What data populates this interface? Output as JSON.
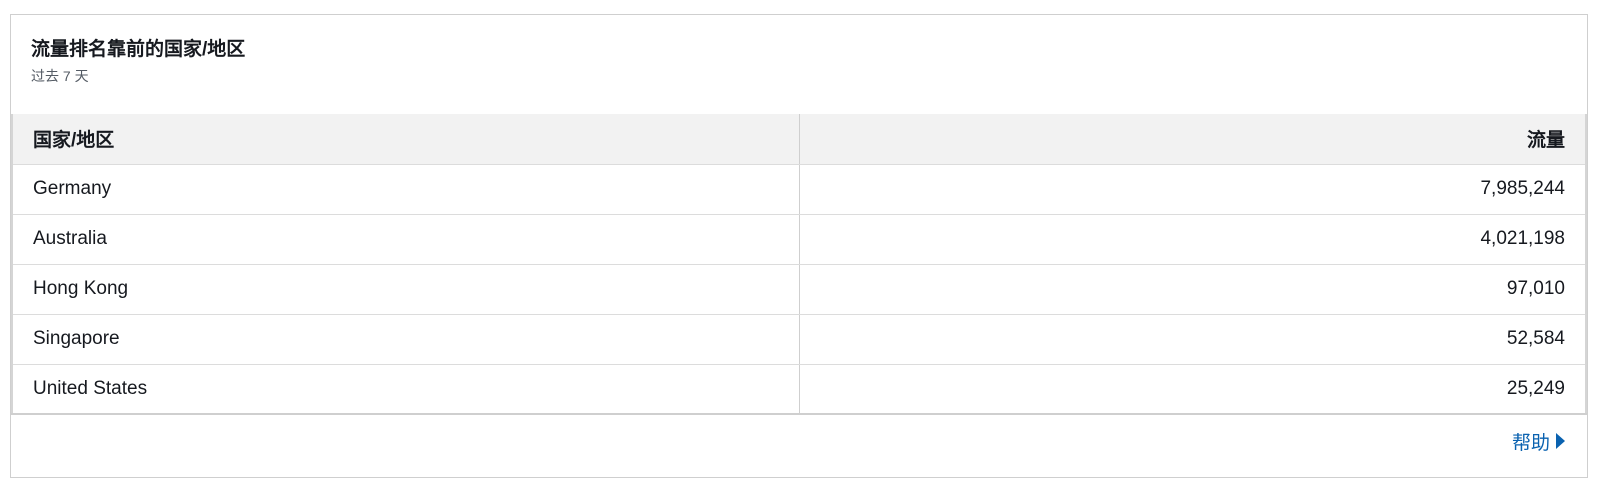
{
  "panel": {
    "title": "流量排名靠前的国家/地区",
    "subtitle": "过去 7 天"
  },
  "table": {
    "headers": {
      "country": "国家/地区",
      "traffic": "流量"
    },
    "rows": [
      {
        "country": "Germany",
        "traffic": "7,985,244"
      },
      {
        "country": "Australia",
        "traffic": "4,021,198"
      },
      {
        "country": "Hong Kong",
        "traffic": "97,010"
      },
      {
        "country": "Singapore",
        "traffic": "52,584"
      },
      {
        "country": "United States",
        "traffic": "25,249"
      }
    ]
  },
  "footer": {
    "help_label": "帮助",
    "help_icon": "caret-right-icon"
  },
  "colors": {
    "link": "#0a62b0",
    "header_bg": "#f2f2f2"
  }
}
